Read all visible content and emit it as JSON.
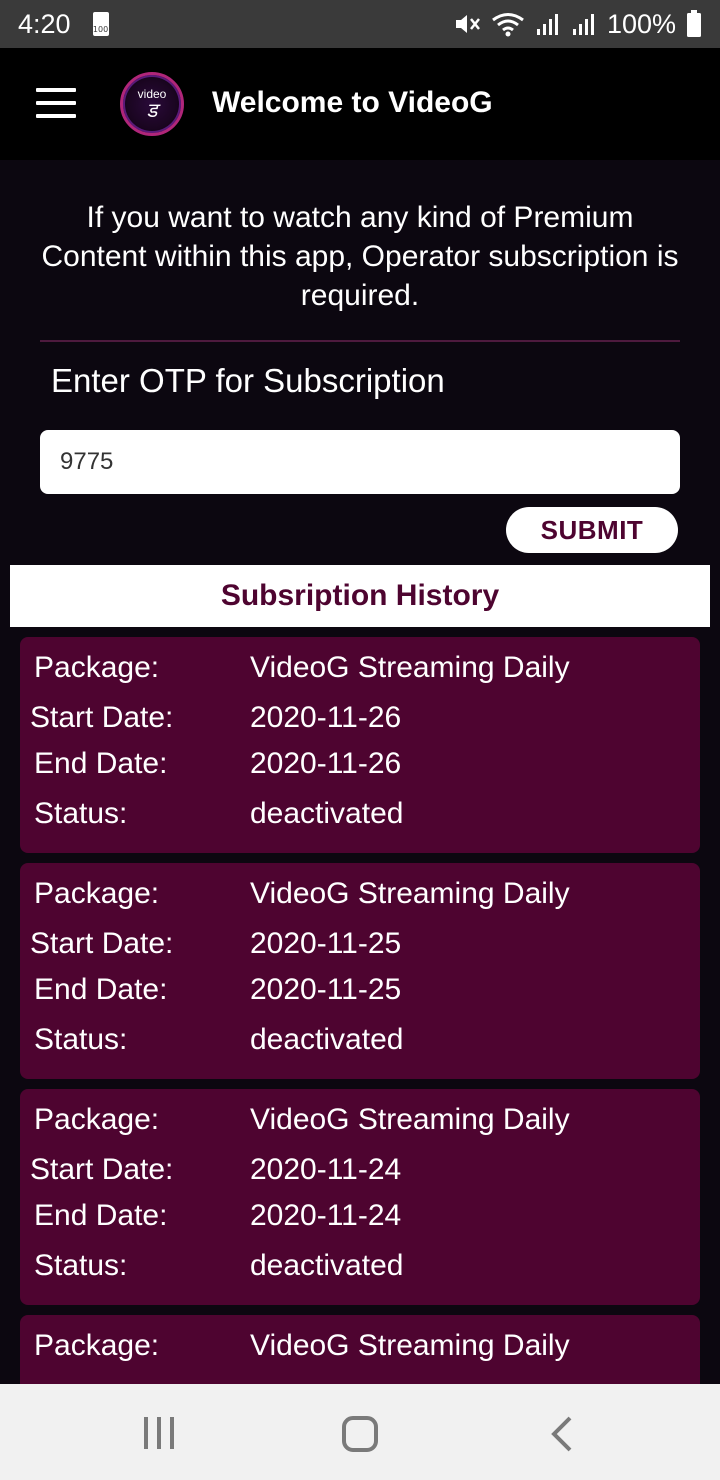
{
  "status_bar": {
    "time": "4:20",
    "battery_small_text": "100",
    "battery_percent": "100%"
  },
  "app_bar": {
    "title": "Welcome to VideoG",
    "logo_text": "video",
    "logo_glyph": "ड"
  },
  "intro_text": "If you want to watch any kind of Premium Content within this app, Operator subscription is required.",
  "otp": {
    "label": "Enter OTP for Subscription",
    "value": "9775",
    "submit_label": "SUBMIT"
  },
  "history": {
    "title": "Subsription History",
    "labels": {
      "package": "Package:",
      "start_date": "Start Date:",
      "end_date": "End Date:",
      "status": "Status:"
    },
    "entries": [
      {
        "package": "VideoG Streaming Daily",
        "start_date": "2020-11-26",
        "end_date": "2020-11-26",
        "status": "deactivated"
      },
      {
        "package": "VideoG Streaming Daily",
        "start_date": "2020-11-25",
        "end_date": "2020-11-25",
        "status": "deactivated"
      },
      {
        "package": "VideoG Streaming Daily",
        "start_date": "2020-11-24",
        "end_date": "2020-11-24",
        "status": "deactivated"
      },
      {
        "package": "VideoG Streaming Daily"
      }
    ]
  },
  "colors": {
    "background": "#0c0710",
    "card": "#4e0430",
    "accent_text": "#4e0430",
    "status_bar": "#3a3a3a",
    "nav_bar": "#f1f1f1"
  },
  "icons": [
    "menu-icon",
    "mute-icon",
    "wifi-icon",
    "signal-icon",
    "battery-icon",
    "recents-icon",
    "home-icon",
    "back-icon"
  ]
}
